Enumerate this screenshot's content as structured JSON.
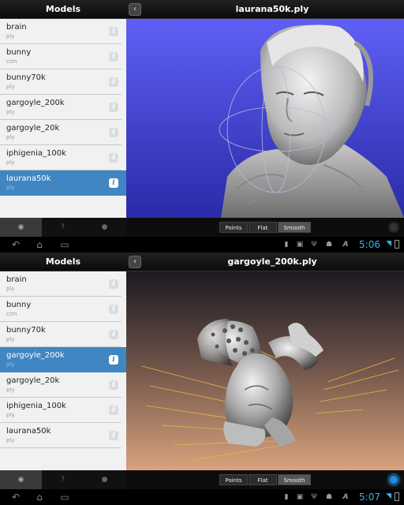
{
  "panels": [
    {
      "left_title": "Models",
      "back_label": "‹",
      "right_title": "laurana50k.ply",
      "items": [
        {
          "name": "brain",
          "ext": "ply"
        },
        {
          "name": "bunny",
          "ext": "ctm"
        },
        {
          "name": "bunny70k",
          "ext": "ply"
        },
        {
          "name": "gargoyle_200k",
          "ext": "ply"
        },
        {
          "name": "gargoyle_20k",
          "ext": "ply"
        },
        {
          "name": "iphigenia_100k",
          "ext": "ply"
        },
        {
          "name": "laurana50k",
          "ext": "ply"
        }
      ],
      "selected_index": 6,
      "info_glyph": "i",
      "tabs": [
        {
          "glyph": "◉"
        },
        {
          "glyph": "?"
        },
        {
          "glyph": "●"
        }
      ],
      "active_tab": 0,
      "modes": [
        "Points",
        "Flat",
        "Smooth"
      ],
      "active_mode": 2,
      "time": "5:06"
    },
    {
      "left_title": "Models",
      "back_label": "‹",
      "right_title": "gargoyle_200k.ply",
      "items": [
        {
          "name": "brain",
          "ext": "ply"
        },
        {
          "name": "bunny",
          "ext": "ctm"
        },
        {
          "name": "bunny70k",
          "ext": "ply"
        },
        {
          "name": "gargoyle_200k",
          "ext": "ply"
        },
        {
          "name": "gargoyle_20k",
          "ext": "ply"
        },
        {
          "name": "iphigenia_100k",
          "ext": "ply"
        },
        {
          "name": "laurana50k",
          "ext": "ply"
        }
      ],
      "selected_index": 3,
      "info_glyph": "i",
      "tabs": [
        {
          "glyph": "◉"
        },
        {
          "glyph": "?"
        },
        {
          "glyph": "●"
        }
      ],
      "active_tab": 0,
      "modes": [
        "Points",
        "Flat",
        "Smooth"
      ],
      "active_mode": 2,
      "time": "5:07"
    }
  ],
  "system": {
    "nav_icons": [
      "back-icon",
      "home-icon",
      "recent-apps-icon"
    ],
    "nav_glyphs": [
      "↶",
      "⌂",
      "▭"
    ],
    "status_icons": [
      "sd-card-icon",
      "image-icon",
      "usb-icon",
      "android-icon",
      "text-icon"
    ],
    "status_glyphs": [
      "▮",
      "▣",
      "Ψ",
      "☗",
      "A"
    ],
    "accent": "#33b5e5",
    "selection_color": "#3f86c2"
  }
}
